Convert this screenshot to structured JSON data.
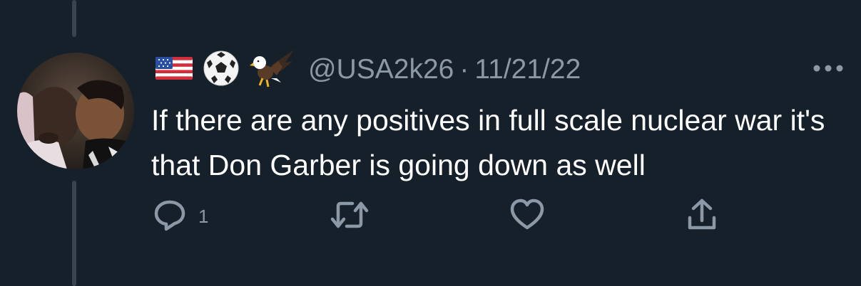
{
  "tweet": {
    "handle": "@USA2k26",
    "separator": "·",
    "date": "11/21/22",
    "text": "If there are any positives in full scale nuclear war it's that Don Garber is going down as well",
    "name_emojis": [
      "us-flag-icon",
      "soccer-ball-icon",
      "eagle-icon"
    ]
  },
  "actions": {
    "reply_count": "1"
  },
  "colors": {
    "background": "#15202b",
    "secondary_text": "#8b98a5",
    "primary_text": "#ffffff",
    "thread_line": "#38444d"
  }
}
